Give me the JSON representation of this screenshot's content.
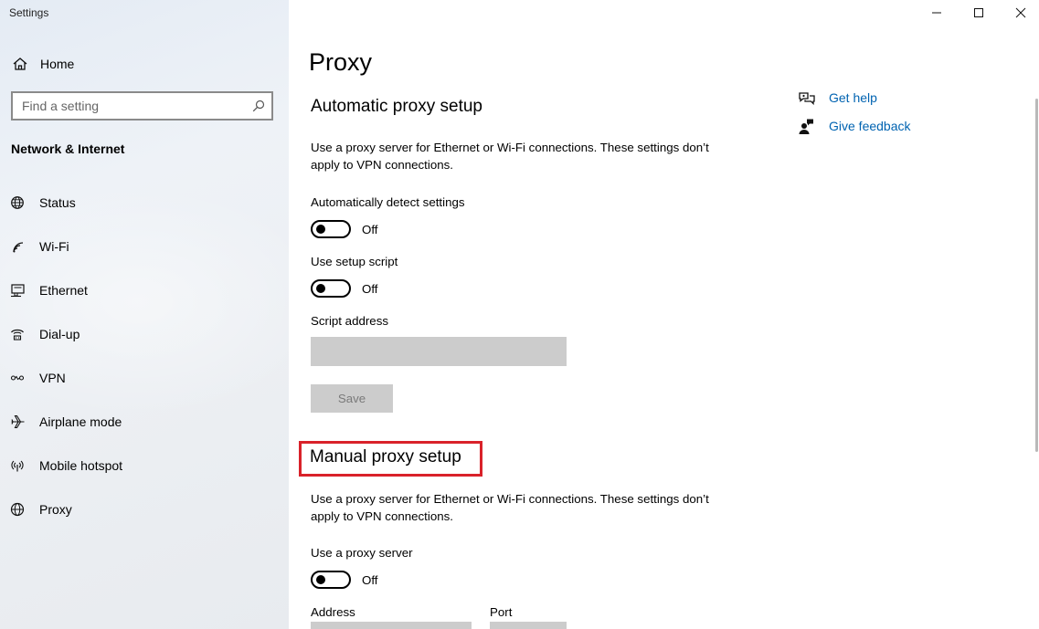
{
  "window": {
    "app_title": "Settings",
    "controls": {
      "minimize": "minimize-icon",
      "maximize": "maximize-icon",
      "close": "close-icon"
    }
  },
  "sidebar": {
    "home_label": "Home",
    "search_placeholder": "Find a setting",
    "section_title": "Network & Internet",
    "items": [
      {
        "label": "Status",
        "icon": "globe-status-icon"
      },
      {
        "label": "Wi-Fi",
        "icon": "wifi-icon"
      },
      {
        "label": "Ethernet",
        "icon": "ethernet-icon"
      },
      {
        "label": "Dial-up",
        "icon": "dialup-icon"
      },
      {
        "label": "VPN",
        "icon": "vpn-icon"
      },
      {
        "label": "Airplane mode",
        "icon": "airplane-icon"
      },
      {
        "label": "Mobile hotspot",
        "icon": "hotspot-icon"
      },
      {
        "label": "Proxy",
        "icon": "globe-icon"
      }
    ]
  },
  "main": {
    "title": "Proxy",
    "automatic": {
      "heading": "Automatic proxy setup",
      "description": "Use a proxy server for Ethernet or Wi-Fi connections. These settings don’t apply to VPN connections.",
      "auto_detect_label": "Automatically detect settings",
      "auto_detect_state": "Off",
      "setup_script_label": "Use setup script",
      "setup_script_state": "Off",
      "script_address_label": "Script address",
      "script_address_value": "",
      "save_label": "Save"
    },
    "manual": {
      "heading": "Manual proxy setup",
      "description": "Use a proxy server for Ethernet or Wi-Fi connections. These settings don’t apply to VPN connections.",
      "use_proxy_label": "Use a proxy server",
      "use_proxy_state": "Off",
      "address_label": "Address",
      "port_label": "Port"
    }
  },
  "help": {
    "get_help": "Get help",
    "give_feedback": "Give feedback"
  },
  "colors": {
    "link": "#0063b1",
    "highlight": "#d9222a",
    "disabled_field": "#cccccc"
  }
}
